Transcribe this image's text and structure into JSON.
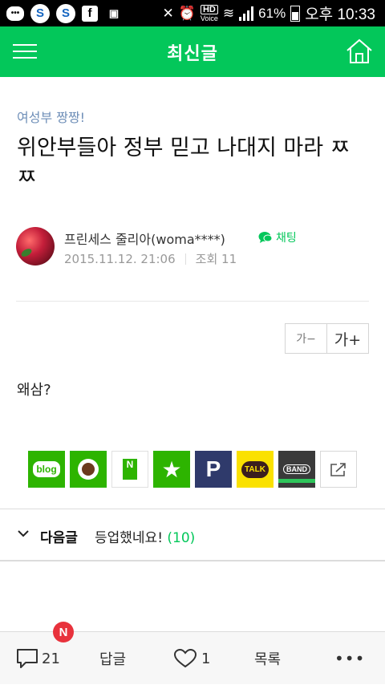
{
  "status_bar": {
    "battery": "61%",
    "hd_label": "HD",
    "voice_label": "Voice",
    "time": "오후 10:33"
  },
  "header": {
    "title": "최신글",
    "menu_icon": "hamburger-icon",
    "home_icon": "home-icon"
  },
  "post": {
    "category": "여성부 짱짱!",
    "title": "위안부들아 정부 믿고 나대지 마라 ㅉㅉ",
    "author": "프린세스 줄리아(woma****)",
    "chat_label": "채팅",
    "date": "2015.11.12. 21:06",
    "views_label": "조회 11",
    "body": "왜삼?"
  },
  "font_controls": {
    "decrease": "가−",
    "increase": "가+"
  },
  "share": {
    "blog": "blog",
    "memo": "N",
    "pholar": "P",
    "talk": "TALK",
    "band": "BAND"
  },
  "next_post": {
    "label": "다음글",
    "title": "등업했네요!",
    "count": "(10)"
  },
  "bottom_bar": {
    "comments_count": "21",
    "new_badge": "N",
    "reply_label": "답글",
    "likes_count": "1",
    "list_label": "목록"
  },
  "colors": {
    "brand_green": "#03c75a",
    "category_blue": "#6f8fb8"
  }
}
